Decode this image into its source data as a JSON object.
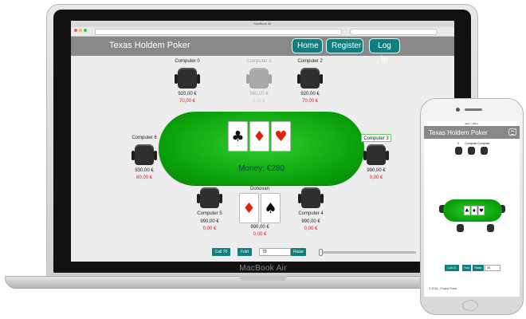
{
  "browser": {
    "window_title": "MacBook Air"
  },
  "site": {
    "title": "Texas Holdem Poker",
    "nav": [
      "Home",
      "Register",
      "Log in"
    ]
  },
  "laptop": {
    "brand": "MacBook Air"
  },
  "players": {
    "c0": {
      "name": "Computer 0",
      "money": "920,00 €",
      "bet": "70,00 €"
    },
    "c1": {
      "name": "Computer 1",
      "money": "990,00 €",
      "bet": "0,00 €"
    },
    "c2": {
      "name": "Computer 2",
      "money": "920,00 €",
      "bet": "70,00 €"
    },
    "c3": {
      "name": "Computer 3",
      "money": "990,00 €",
      "bet": "0,00 €"
    },
    "c4": {
      "name": "Computer 4",
      "money": "990,00 €",
      "bet": "0,00 €"
    },
    "c5": {
      "name": "Computer 5",
      "money": "990,00 €",
      "bet": "0,00 €"
    },
    "c6": {
      "name": "Computer 6",
      "money": "930,00 €",
      "bet": "60,00 €"
    },
    "you": {
      "name": "Donovan",
      "money": "990,00 €",
      "bet": "0,00 €"
    }
  },
  "table": {
    "pot": "Money: €280"
  },
  "community_cards": [
    {
      "label": "♣",
      "color": "#111111"
    },
    {
      "label": "♦",
      "color": "#dd2211"
    },
    {
      "label": "♥",
      "color": "#dd2211"
    }
  ],
  "hand_cards": [
    {
      "label": "♦",
      "color": "#dd2211"
    },
    {
      "label": "♠",
      "color": "#111111"
    }
  ],
  "actions": {
    "call": "Call 70",
    "fold": "Fold",
    "amount": "70",
    "raise": "Raise"
  },
  "phone": {
    "status": "●●●○○ BELL",
    "title": "Texas Holdem Poker",
    "p0": "0",
    "p1": "Computer",
    "p2": "Computer",
    "call": "Call 21",
    "fold": "Fold",
    "raise": "Raise",
    "amount": "30",
    "footer": "© 2016 - Project Poker"
  }
}
